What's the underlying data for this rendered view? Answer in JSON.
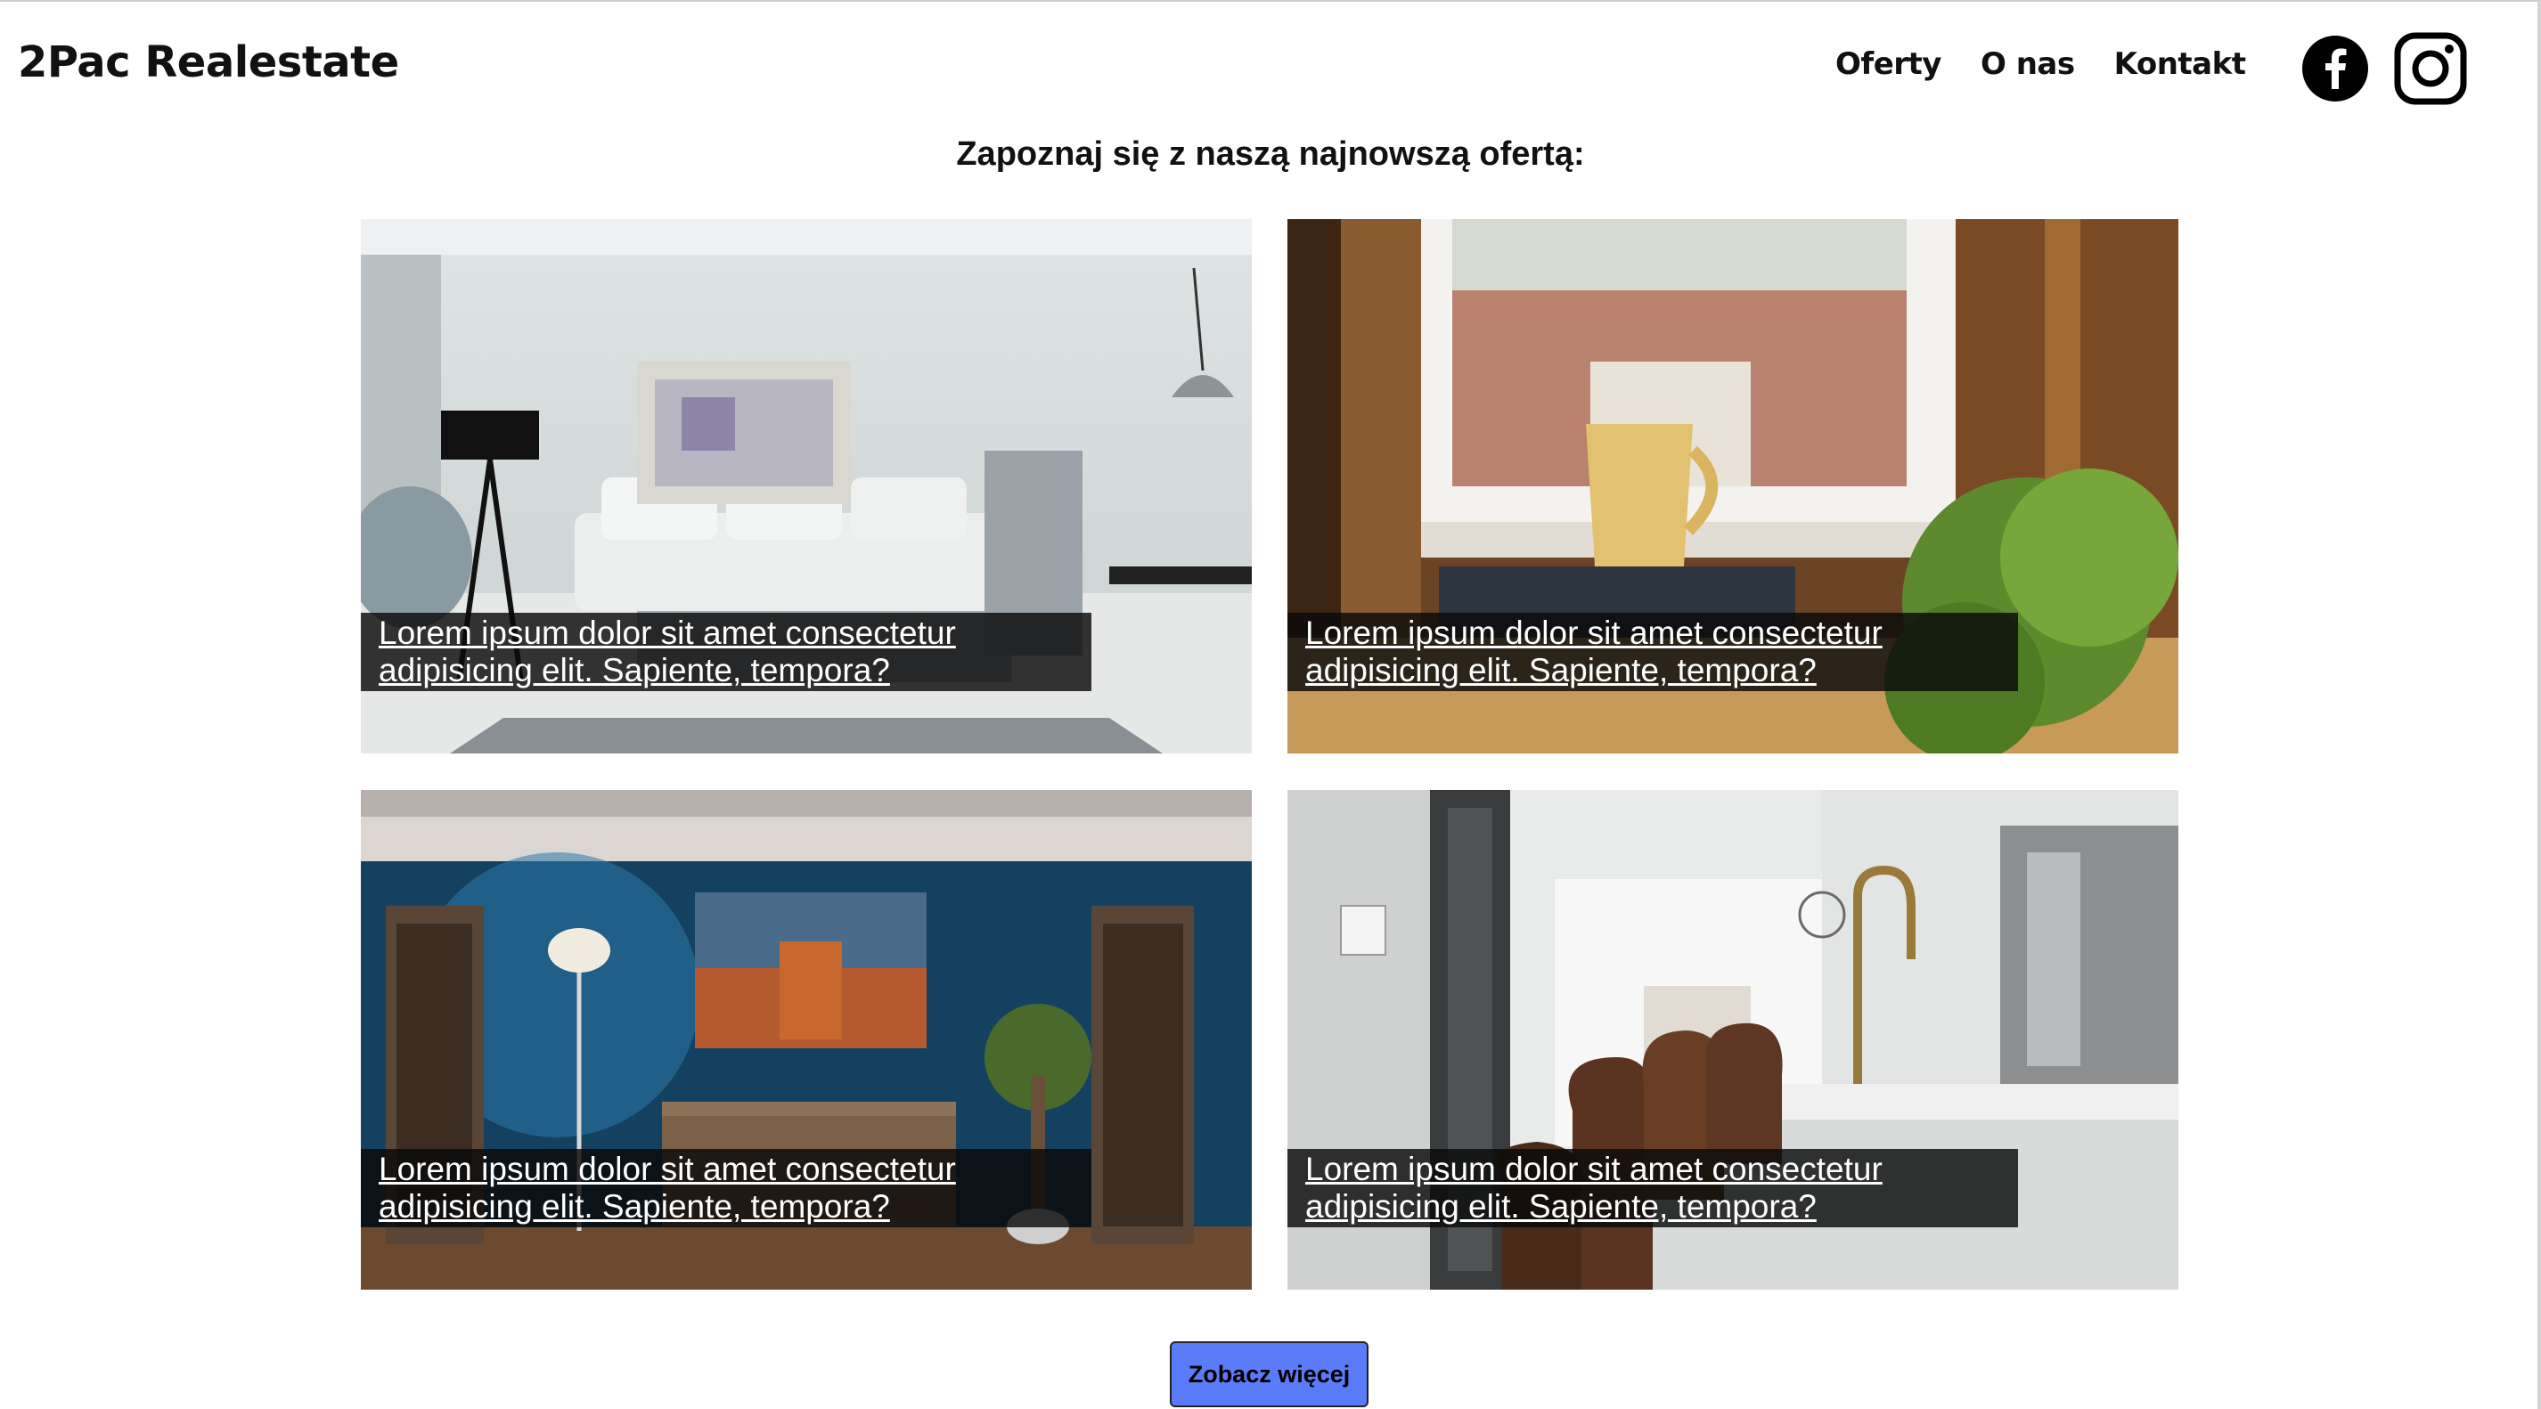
{
  "header": {
    "logo": "2Pac Realestate",
    "nav": [
      "Oferty",
      "O nas",
      "Kontakt"
    ]
  },
  "social": {
    "facebook": "facebook-icon",
    "instagram": "instagram-icon"
  },
  "main": {
    "heading": "Zapoznaj się z naszą najnowszą ofertą:",
    "cards": [
      {
        "caption": "Lorem ipsum dolor sit amet consectetur adipisicing elit. Sapiente, tempora?",
        "image": "living-room-photo"
      },
      {
        "caption": "Lorem ipsum dolor sit amet consectetur adipisicing elit. Sapiente, tempora?",
        "image": "window-mug-photo"
      },
      {
        "caption": "Lorem ipsum dolor sit amet consectetur adipisicing elit. Sapiente, tempora?",
        "image": "blue-room-photo"
      },
      {
        "caption": "Lorem ipsum dolor sit amet consectetur adipisicing elit. Sapiente, tempora?",
        "image": "kitchen-photo"
      }
    ],
    "more_button": "Zobacz więcej"
  },
  "colors": {
    "button": "#5b7cfa",
    "caption_bg": "#0a0a0a",
    "text": "#111111"
  }
}
